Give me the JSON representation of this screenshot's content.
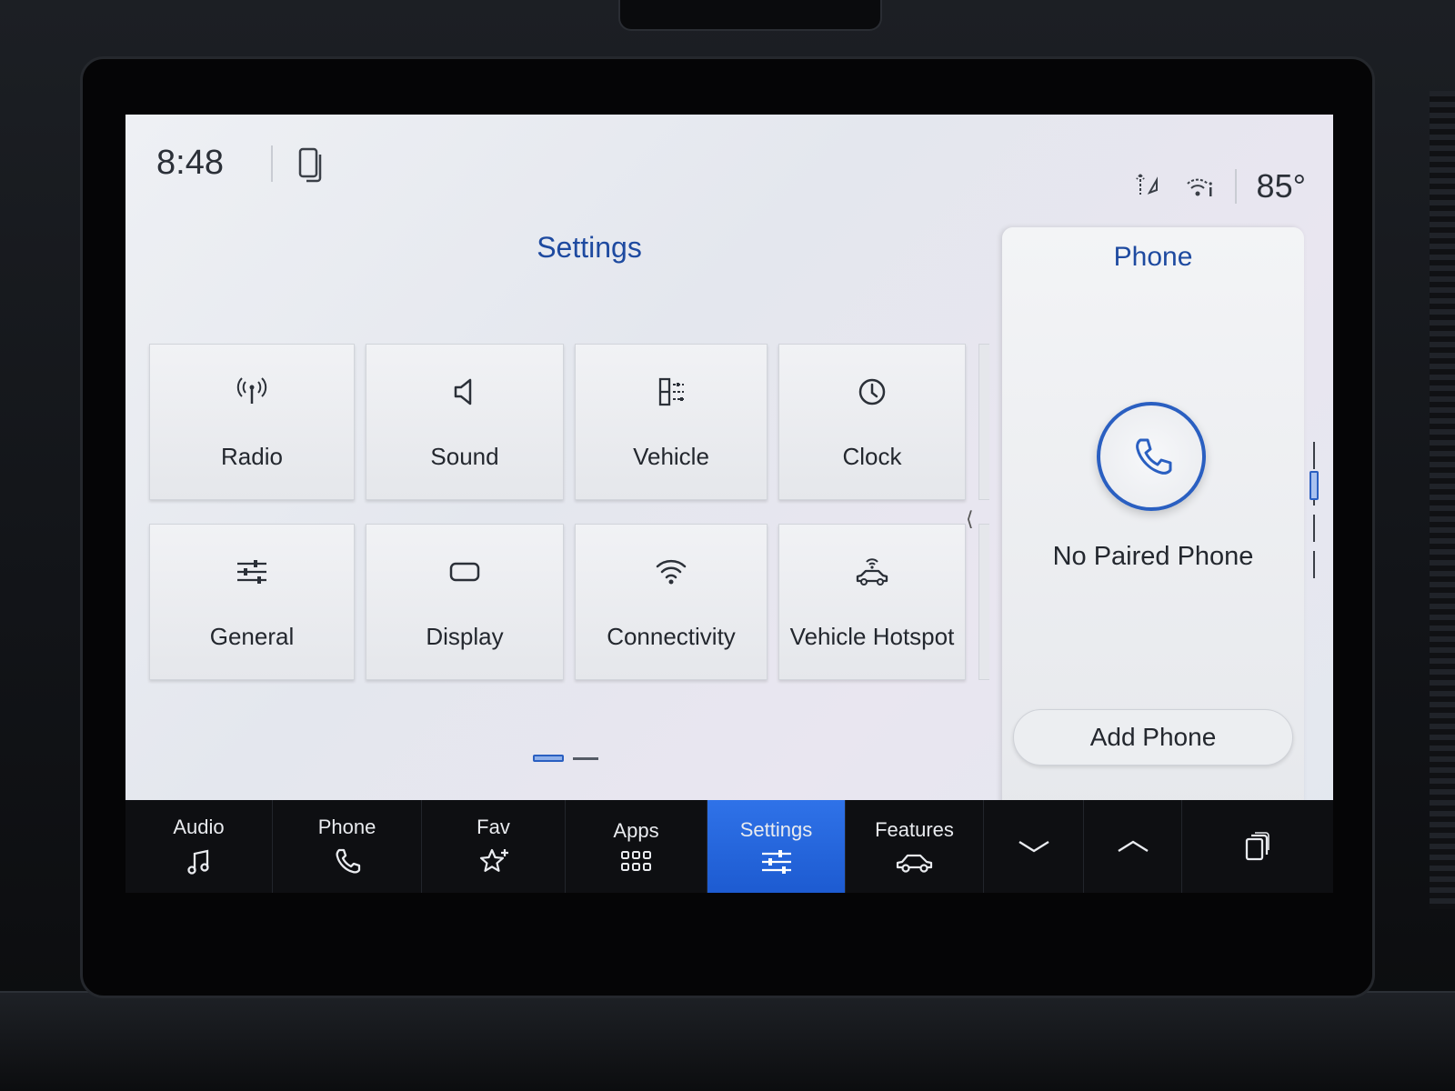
{
  "status": {
    "time": "8:48",
    "temperature": "85°"
  },
  "settings": {
    "title": "Settings",
    "tiles": [
      {
        "label": "Radio",
        "icon": "radio-antenna-icon"
      },
      {
        "label": "Sound",
        "icon": "speaker-icon"
      },
      {
        "label": "Vehicle",
        "icon": "vehicle-settings-icon"
      },
      {
        "label": "Clock",
        "icon": "clock-icon"
      },
      {
        "label": "General",
        "icon": "sliders-icon"
      },
      {
        "label": "Display",
        "icon": "display-icon"
      },
      {
        "label": "Connectivity",
        "icon": "wifi-icon"
      },
      {
        "label": "Vehicle Hotspot",
        "icon": "car-hotspot-icon"
      }
    ]
  },
  "phone_panel": {
    "title": "Phone",
    "status": "No Paired Phone",
    "add_button": "Add Phone"
  },
  "navbar": {
    "items": [
      {
        "label": "Audio",
        "icon": "music-note-icon"
      },
      {
        "label": "Phone",
        "icon": "phone-icon"
      },
      {
        "label": "Fav",
        "icon": "star-add-icon"
      },
      {
        "label": "Apps",
        "icon": "apps-grid-icon"
      },
      {
        "label": "Settings",
        "icon": "sliders-icon",
        "active": true
      },
      {
        "label": "Features",
        "icon": "car-icon"
      }
    ],
    "controls": [
      "chevron-down-icon",
      "chevron-up-icon",
      "screens-icon"
    ]
  },
  "colors": {
    "accent": "#1e4aa0",
    "active_tab": "#2f72e8",
    "navbar_bg": "#0e0f12"
  }
}
